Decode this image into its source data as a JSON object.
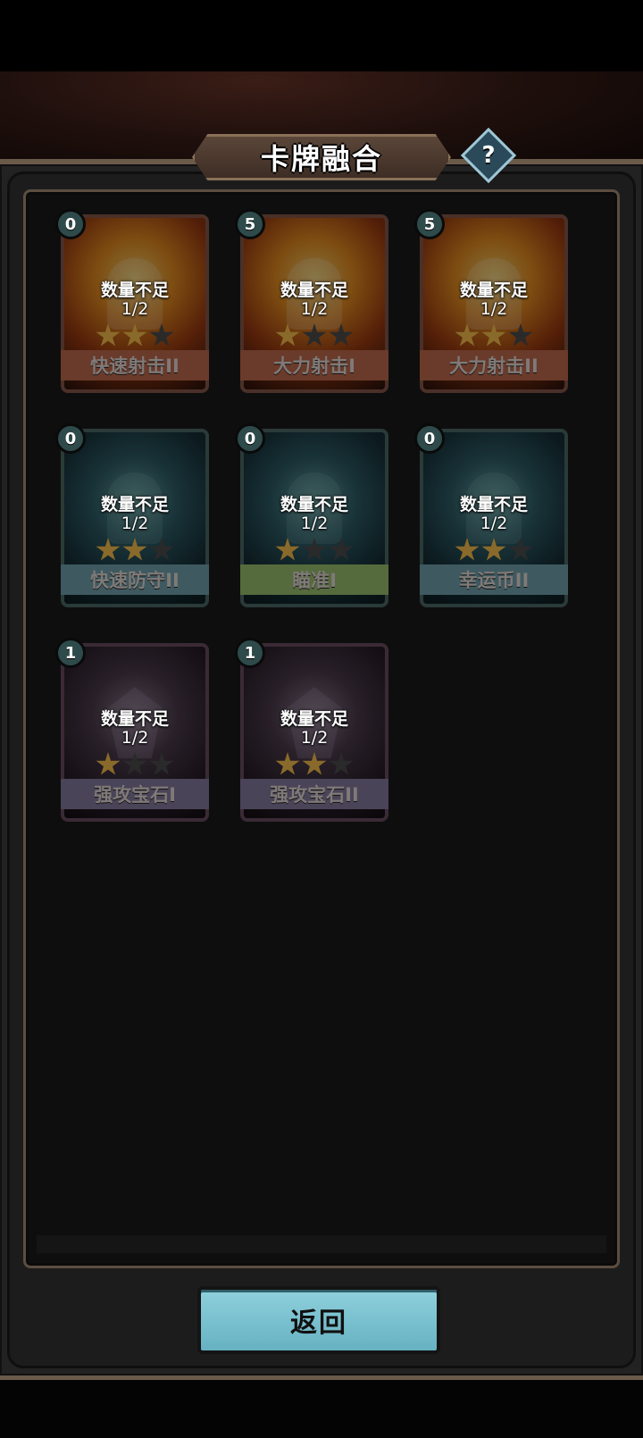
{
  "header": {
    "title": "卡牌融合",
    "help_label": "?"
  },
  "status": {
    "insufficient_label": "数量不足"
  },
  "cards": [
    {
      "name": "快速射击II",
      "cost": "0",
      "count": "1/2",
      "stars": 2,
      "theme": "orange"
    },
    {
      "name": "大力射击I",
      "cost": "5",
      "count": "1/2",
      "stars": 1,
      "theme": "orange"
    },
    {
      "name": "大力射击II",
      "cost": "5",
      "count": "1/2",
      "stars": 2,
      "theme": "orange"
    },
    {
      "name": "快速防守II",
      "cost": "0",
      "count": "1/2",
      "stars": 2,
      "theme": "teal"
    },
    {
      "name": "瞄准I",
      "cost": "0",
      "count": "1/2",
      "stars": 1,
      "theme": "teal-green"
    },
    {
      "name": "幸运币II",
      "cost": "0",
      "count": "1/2",
      "stars": 2,
      "theme": "teal"
    },
    {
      "name": "强攻宝石I",
      "cost": "1",
      "count": "1/2",
      "stars": 1,
      "theme": "purple"
    },
    {
      "name": "强攻宝石II",
      "cost": "1",
      "count": "1/2",
      "stars": 2,
      "theme": "purple"
    }
  ],
  "footer": {
    "back_label": "返回"
  },
  "colors": {
    "accent_button": "#7cc3d0",
    "frame_brown": "#5b4d40",
    "star_active": "#8a6a2a"
  }
}
